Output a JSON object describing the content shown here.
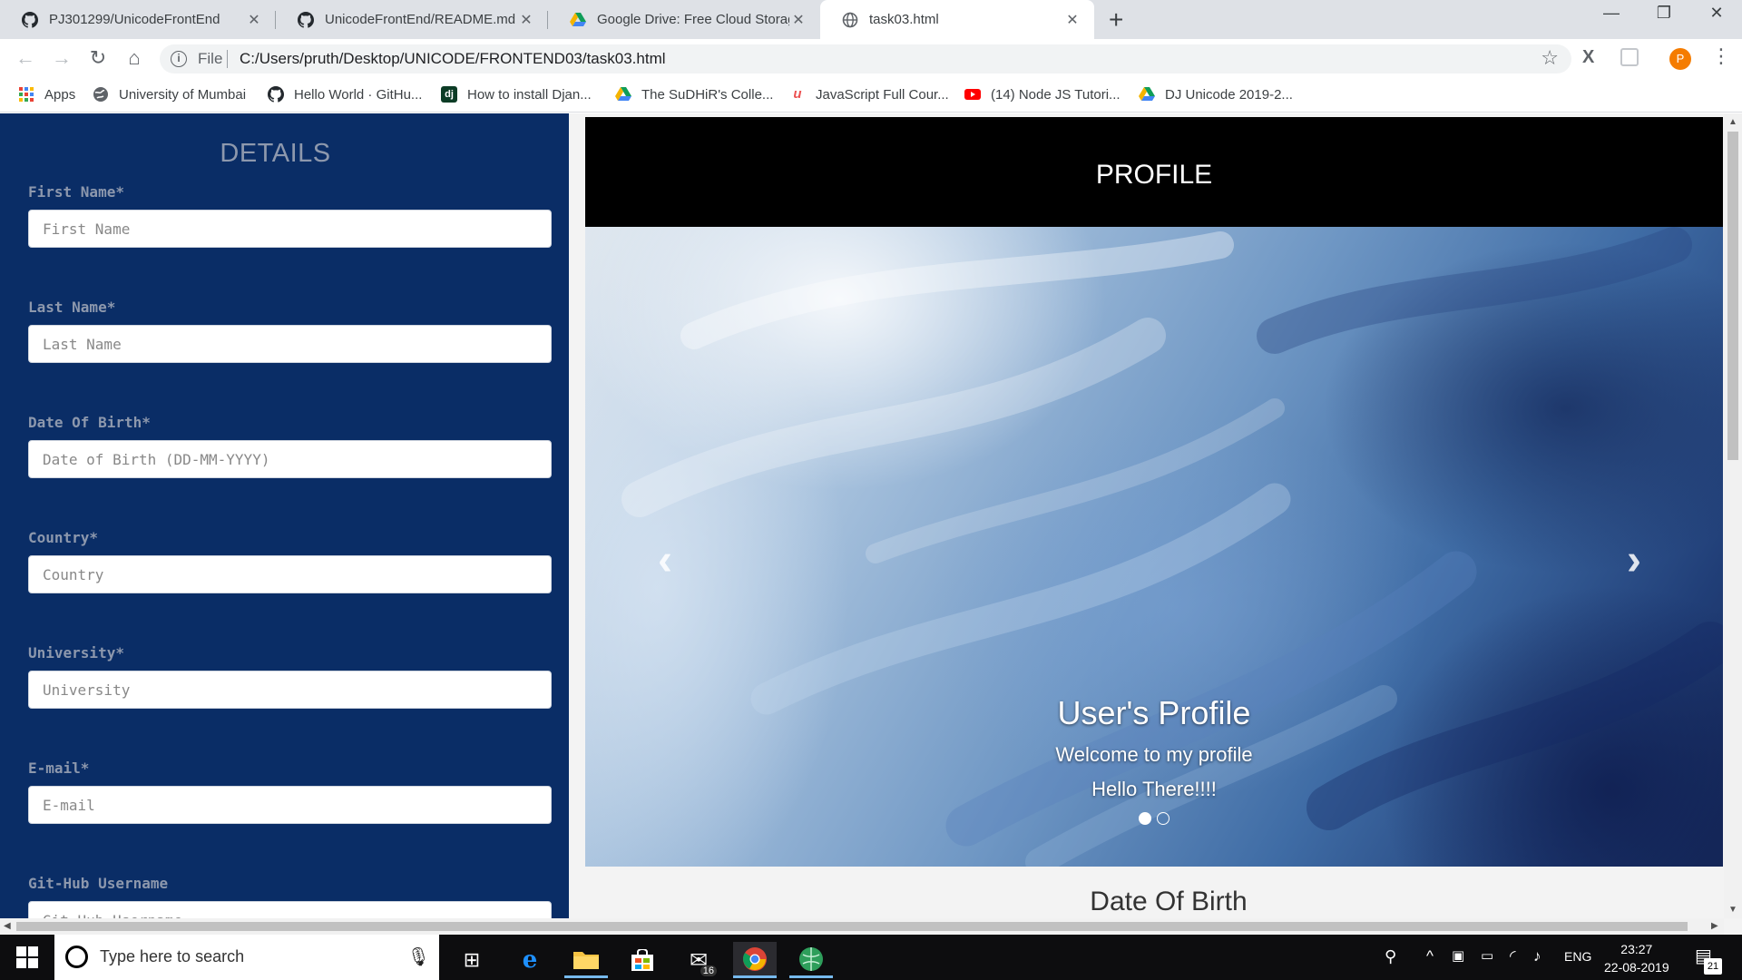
{
  "browser": {
    "tabs": [
      {
        "title": "PJ301299/UnicodeFrontEnd",
        "icon": "github-icon",
        "active": false
      },
      {
        "title": "UnicodeFrontEnd/README.md at",
        "icon": "github-icon",
        "active": false
      },
      {
        "title": "Google Drive: Free Cloud Storage",
        "icon": "google-drive-icon",
        "active": false
      },
      {
        "title": "task03.html",
        "icon": "globe-icon",
        "active": true
      }
    ],
    "file_label": "File",
    "url": "C:/Users/pruth/Desktop/UNICODE/FRONTEND03/task03.html",
    "profile_initial": "P",
    "bookmarks": [
      {
        "label": "Apps",
        "icon": "apps-grid-icon"
      },
      {
        "label": "University of Mumbai",
        "icon": "globe-icon"
      },
      {
        "label": "Hello World · GitHu...",
        "icon": "github-icon"
      },
      {
        "label": "How to install Djan...",
        "icon": "django-icon"
      },
      {
        "label": "The SuDHiR's Colle...",
        "icon": "google-drive-icon"
      },
      {
        "label": "JavaScript Full Cour...",
        "icon": "udemy-icon"
      },
      {
        "label": "(14) Node JS Tutori...",
        "icon": "youtube-icon"
      },
      {
        "label": "DJ Unicode 2019-2...",
        "icon": "google-drive-icon"
      }
    ]
  },
  "sidebar": {
    "heading": "DETAILS",
    "fields": [
      {
        "label": "First Name*",
        "placeholder": "First Name",
        "value": ""
      },
      {
        "label": "Last Name*",
        "placeholder": "Last Name",
        "value": ""
      },
      {
        "label": "Date Of Birth*",
        "placeholder": "Date of Birth (DD-MM-YYYY)",
        "value": ""
      },
      {
        "label": "Country*",
        "placeholder": "Country",
        "value": ""
      },
      {
        "label": "University*",
        "placeholder": "University",
        "value": ""
      },
      {
        "label": "E-mail*",
        "placeholder": "E-mail",
        "value": ""
      },
      {
        "label": "Git-Hub Username",
        "placeholder": "Git-Hub Username",
        "value": ""
      }
    ]
  },
  "main": {
    "profile_title": "PROFILE",
    "carousel": {
      "caption_title": "User's Profile",
      "caption_line1": "Welcome to my profile",
      "caption_line2": "Hello There!!!!",
      "slide_count": 2,
      "active_slide": 1,
      "prev_icon": "chevron-left-icon",
      "next_icon": "chevron-right-icon"
    },
    "section_heading": "Date Of Birth"
  },
  "taskbar": {
    "search_placeholder": "Type here to search",
    "mail_badge": "16",
    "language": "ENG",
    "time": "23:27",
    "date": "22-08-2019",
    "notification_count": "21"
  },
  "colors": {
    "sidebar_bg": "#0a2d66",
    "label_color": "#8d98ad",
    "profile_header_bg": "#000000"
  }
}
